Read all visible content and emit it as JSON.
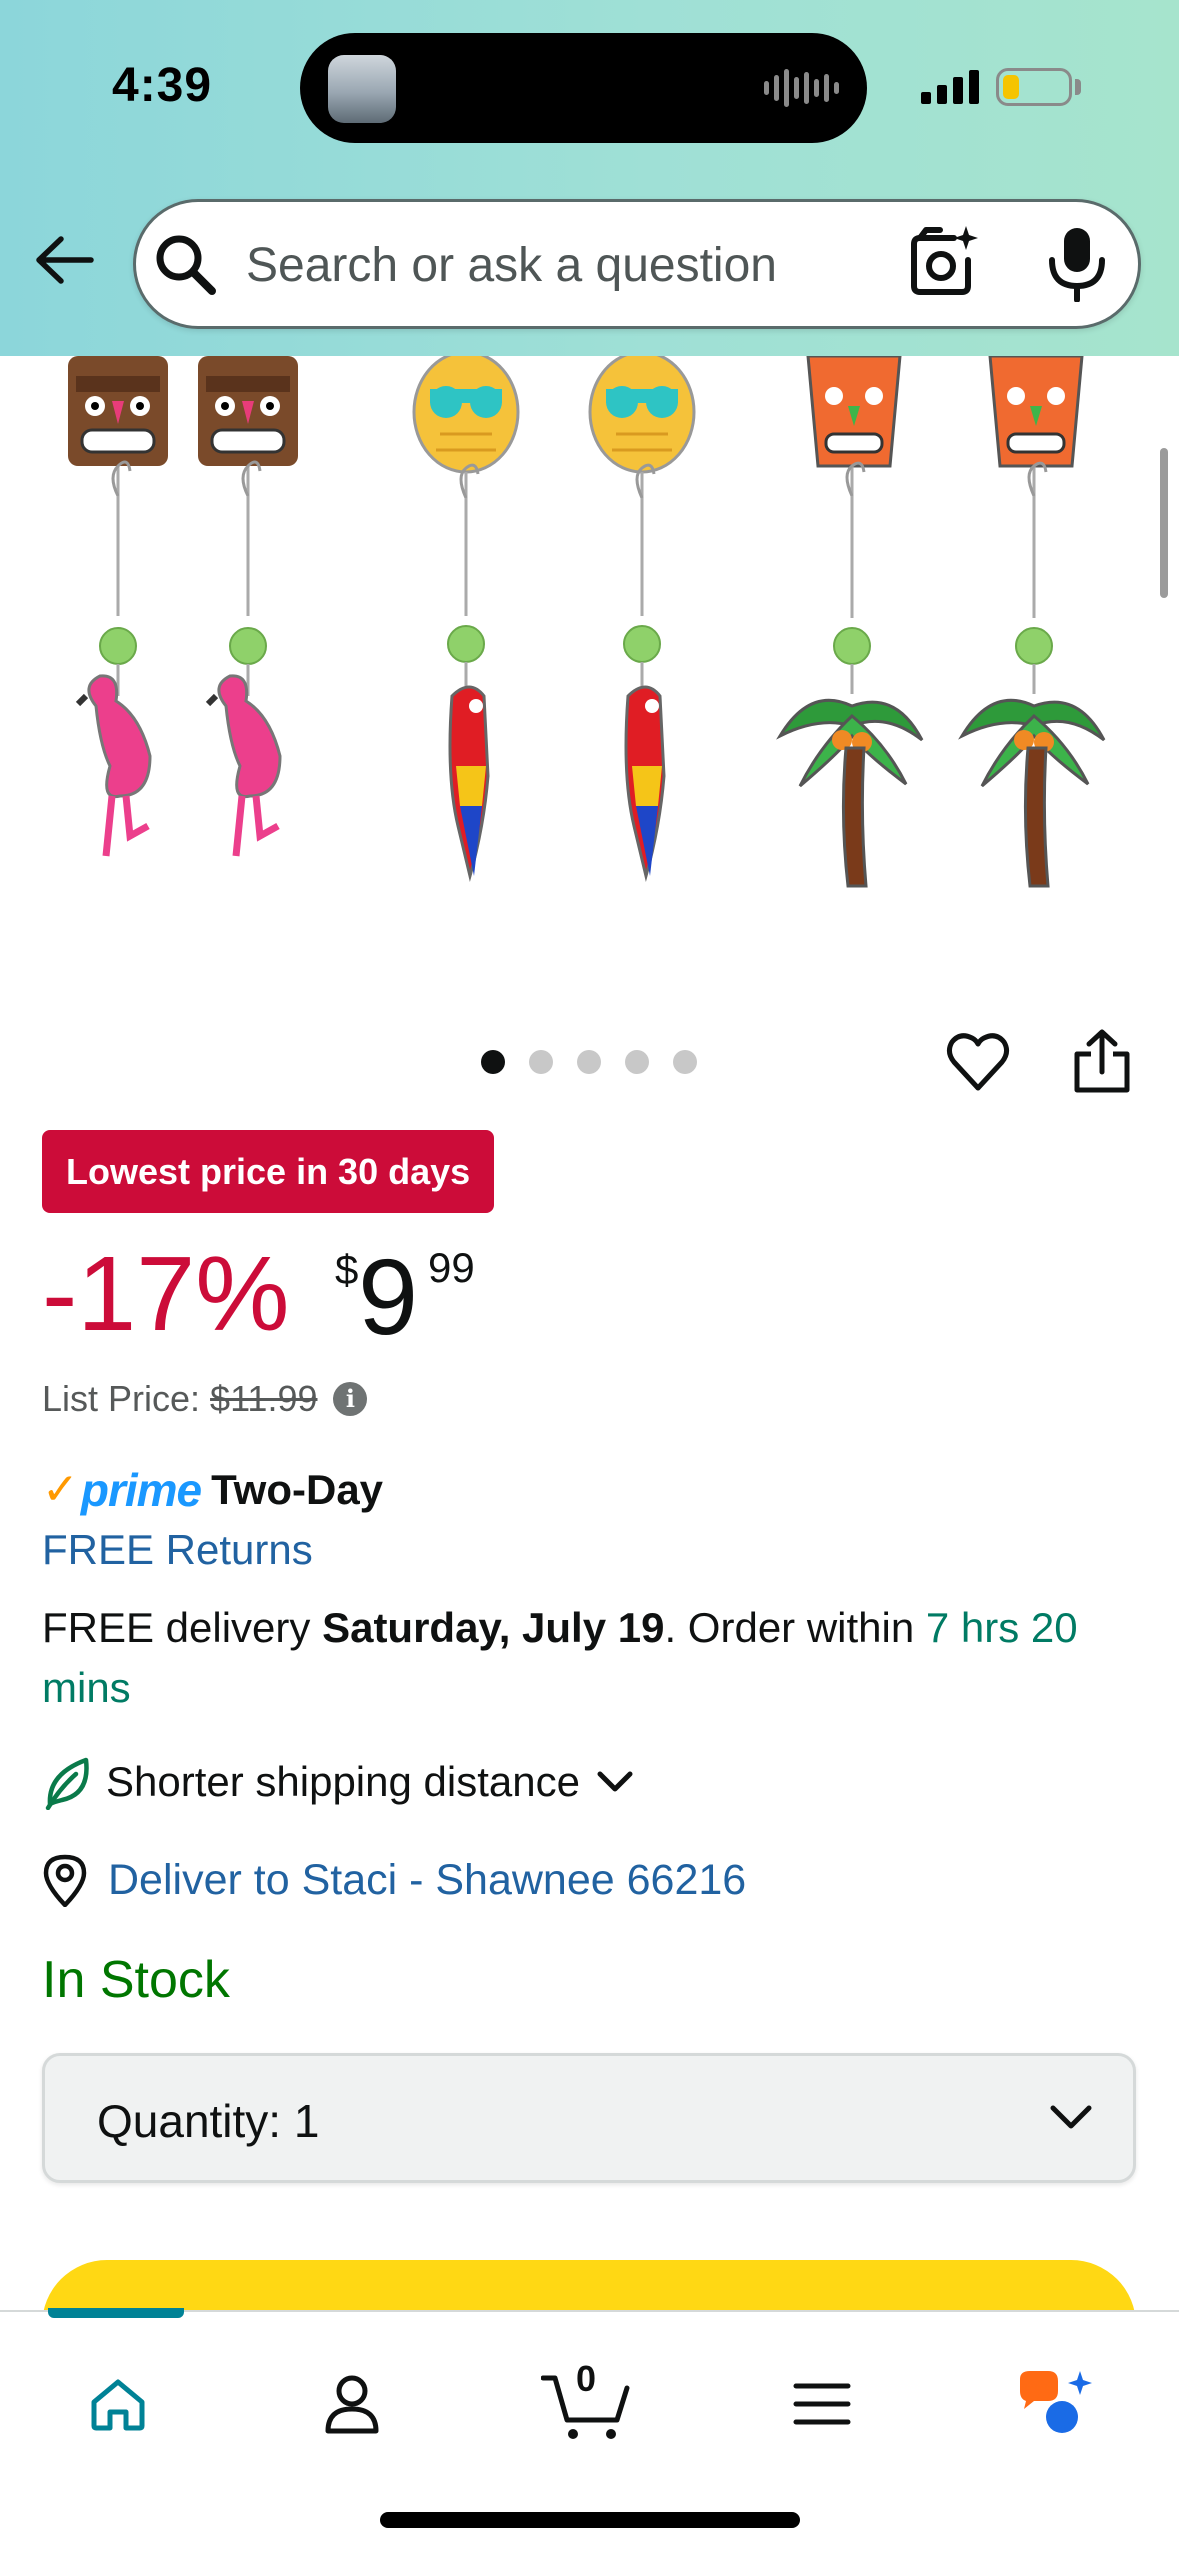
{
  "status_bar": {
    "time": "4:39",
    "battery_level": 0.25
  },
  "header": {
    "search": {
      "placeholder": "Search or ask a question"
    },
    "icons": [
      "back-arrow-icon",
      "search-icon",
      "camera-lens-icon",
      "microphone-icon"
    ]
  },
  "product_image": {
    "alt": "Tropical tiki, pineapple, flamingo, parrot and palm tree dangle earrings",
    "rows": [
      [
        "tiki-mask",
        "pineapple-sunglasses",
        "tiki-mask-green-nose"
      ],
      [
        "flamingo",
        "parrot",
        "palm-tree"
      ]
    ]
  },
  "carousel": {
    "dot_count": 5,
    "active_index": 0
  },
  "badge": {
    "deal": "Lowest price in 30 days"
  },
  "price": {
    "discount": "-17%",
    "currency_symbol": "$",
    "whole": "9",
    "fraction": "99",
    "list_price_label": "List Price:",
    "list_price_value": "$11.99"
  },
  "prime": {
    "check": "✓",
    "word": "prime",
    "speed": "Two-Day"
  },
  "returns": {
    "label": "FREE Returns"
  },
  "delivery": {
    "prefix": "FREE delivery ",
    "date": "Saturday, July 19",
    "middle": ". Order within ",
    "countdown": "7 hrs 20 mins"
  },
  "shipping": {
    "label": "Shorter shipping distance"
  },
  "deliver_to": {
    "label": "Deliver to Staci - Shawnee 66216"
  },
  "stock": {
    "status": "In Stock"
  },
  "quantity": {
    "label": "Quantity:",
    "value": "1"
  },
  "add_to_cart": {
    "label": ""
  },
  "tabbar": {
    "cart_count": "0",
    "tabs": [
      "home-icon",
      "account-icon",
      "cart-icon",
      "menu-icon",
      "rufus-ai-icon"
    ]
  },
  "colors": {
    "header_gradient_start": "#8cd6da",
    "header_gradient_end": "#a6e4cd",
    "deal_red": "#cc0c39",
    "link_blue": "#2162a1",
    "prime_blue": "#1a98ff",
    "prime_orange": "#ff9900",
    "stock_green": "#007600",
    "countdown_green": "#007b64",
    "cart_yellow": "#ffd814",
    "tab_teal": "#008296"
  }
}
